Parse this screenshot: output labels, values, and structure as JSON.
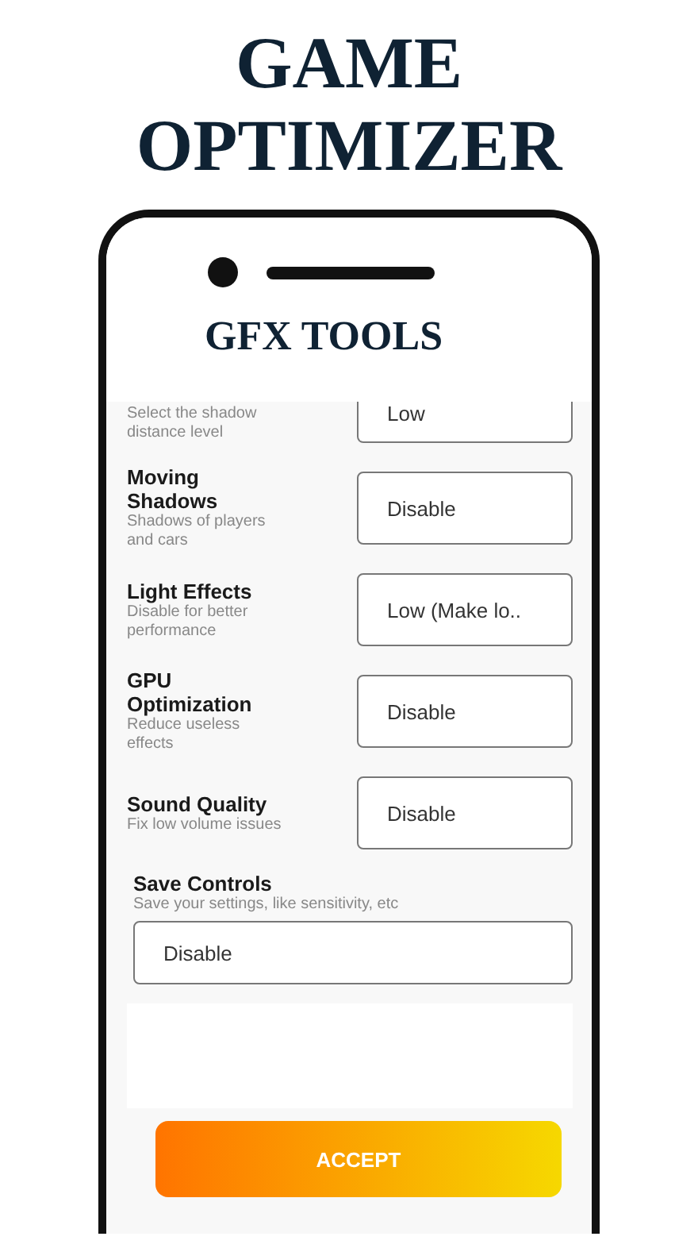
{
  "banner": {
    "title": "GAME OPTIMIZER"
  },
  "app": {
    "title": "GFX TOOLS"
  },
  "options": [
    {
      "description": "Select the shadow distance level",
      "value": "Low"
    },
    {
      "title": "Moving Shadows",
      "description": "Shadows of players and cars",
      "value": "Disable"
    },
    {
      "title": "Light Effects",
      "description": "Disable for better performance",
      "value": "Low (Make lo.."
    },
    {
      "title": "GPU Optimization",
      "description": "Reduce useless effects",
      "value": "Disable"
    },
    {
      "title": "Sound Quality",
      "description": "Fix low volume issues",
      "value": "Disable"
    }
  ],
  "save_controls": {
    "title": "Save Controls",
    "description": "Save your settings, like sensitivity, etc",
    "value": "Disable"
  },
  "accept_button": "ACCEPT"
}
